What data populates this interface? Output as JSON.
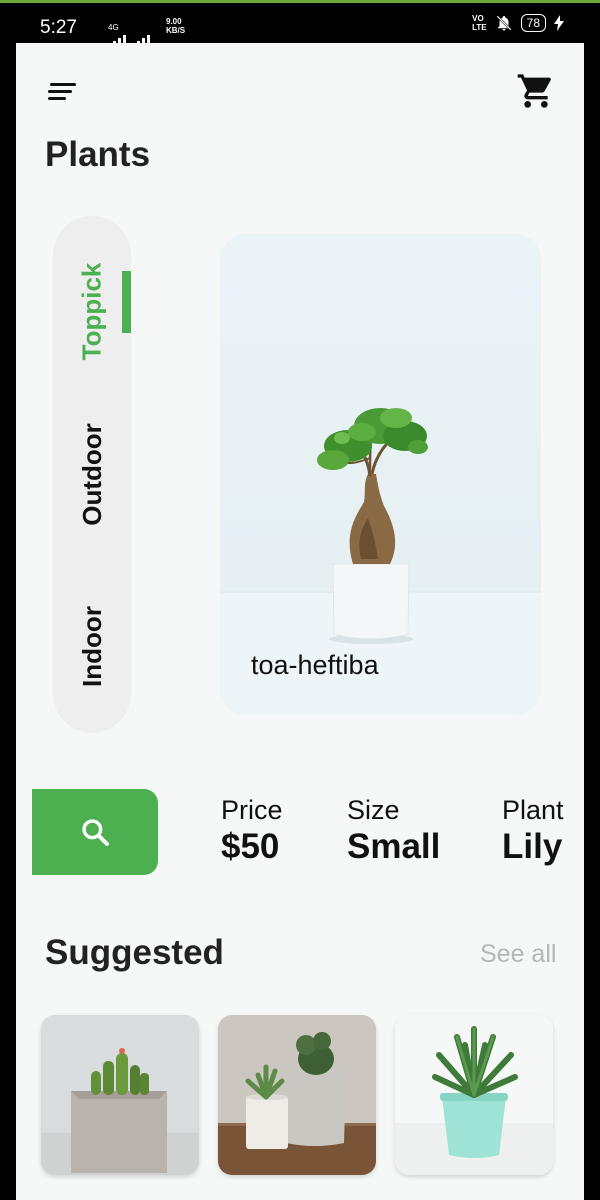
{
  "status_bar": {
    "time": "5:27",
    "network_label": "4G",
    "speed_value": "9.00",
    "speed_unit": "KB/S",
    "volte_line1": "VO",
    "volte_line2": "LTE",
    "battery": "78"
  },
  "header": {
    "menu_icon": "menu-icon",
    "cart_icon": "cart-icon"
  },
  "page_title": "Plants",
  "categories": [
    {
      "label": "Toppick",
      "active": true
    },
    {
      "label": "Outdoor",
      "active": false
    },
    {
      "label": "Indoor",
      "active": false
    }
  ],
  "featured": {
    "caption": "toa-heftiba"
  },
  "details": {
    "search_icon": "search-icon",
    "price_label": "Price",
    "price_value": "$50",
    "size_label": "Size",
    "size_value": "Small",
    "plant_label": "Plant",
    "plant_value": "Lily"
  },
  "suggested": {
    "title": "Suggested",
    "see_all": "See all",
    "items": [
      "cactus-in-concrete-pot",
      "succulents-in-two-pots",
      "aloe-in-mint-pot"
    ]
  },
  "colors": {
    "accent": "#4caf50",
    "background": "#f6f8f7",
    "pill": "#eeeeee",
    "muted_text": "#b5b5b5"
  }
}
